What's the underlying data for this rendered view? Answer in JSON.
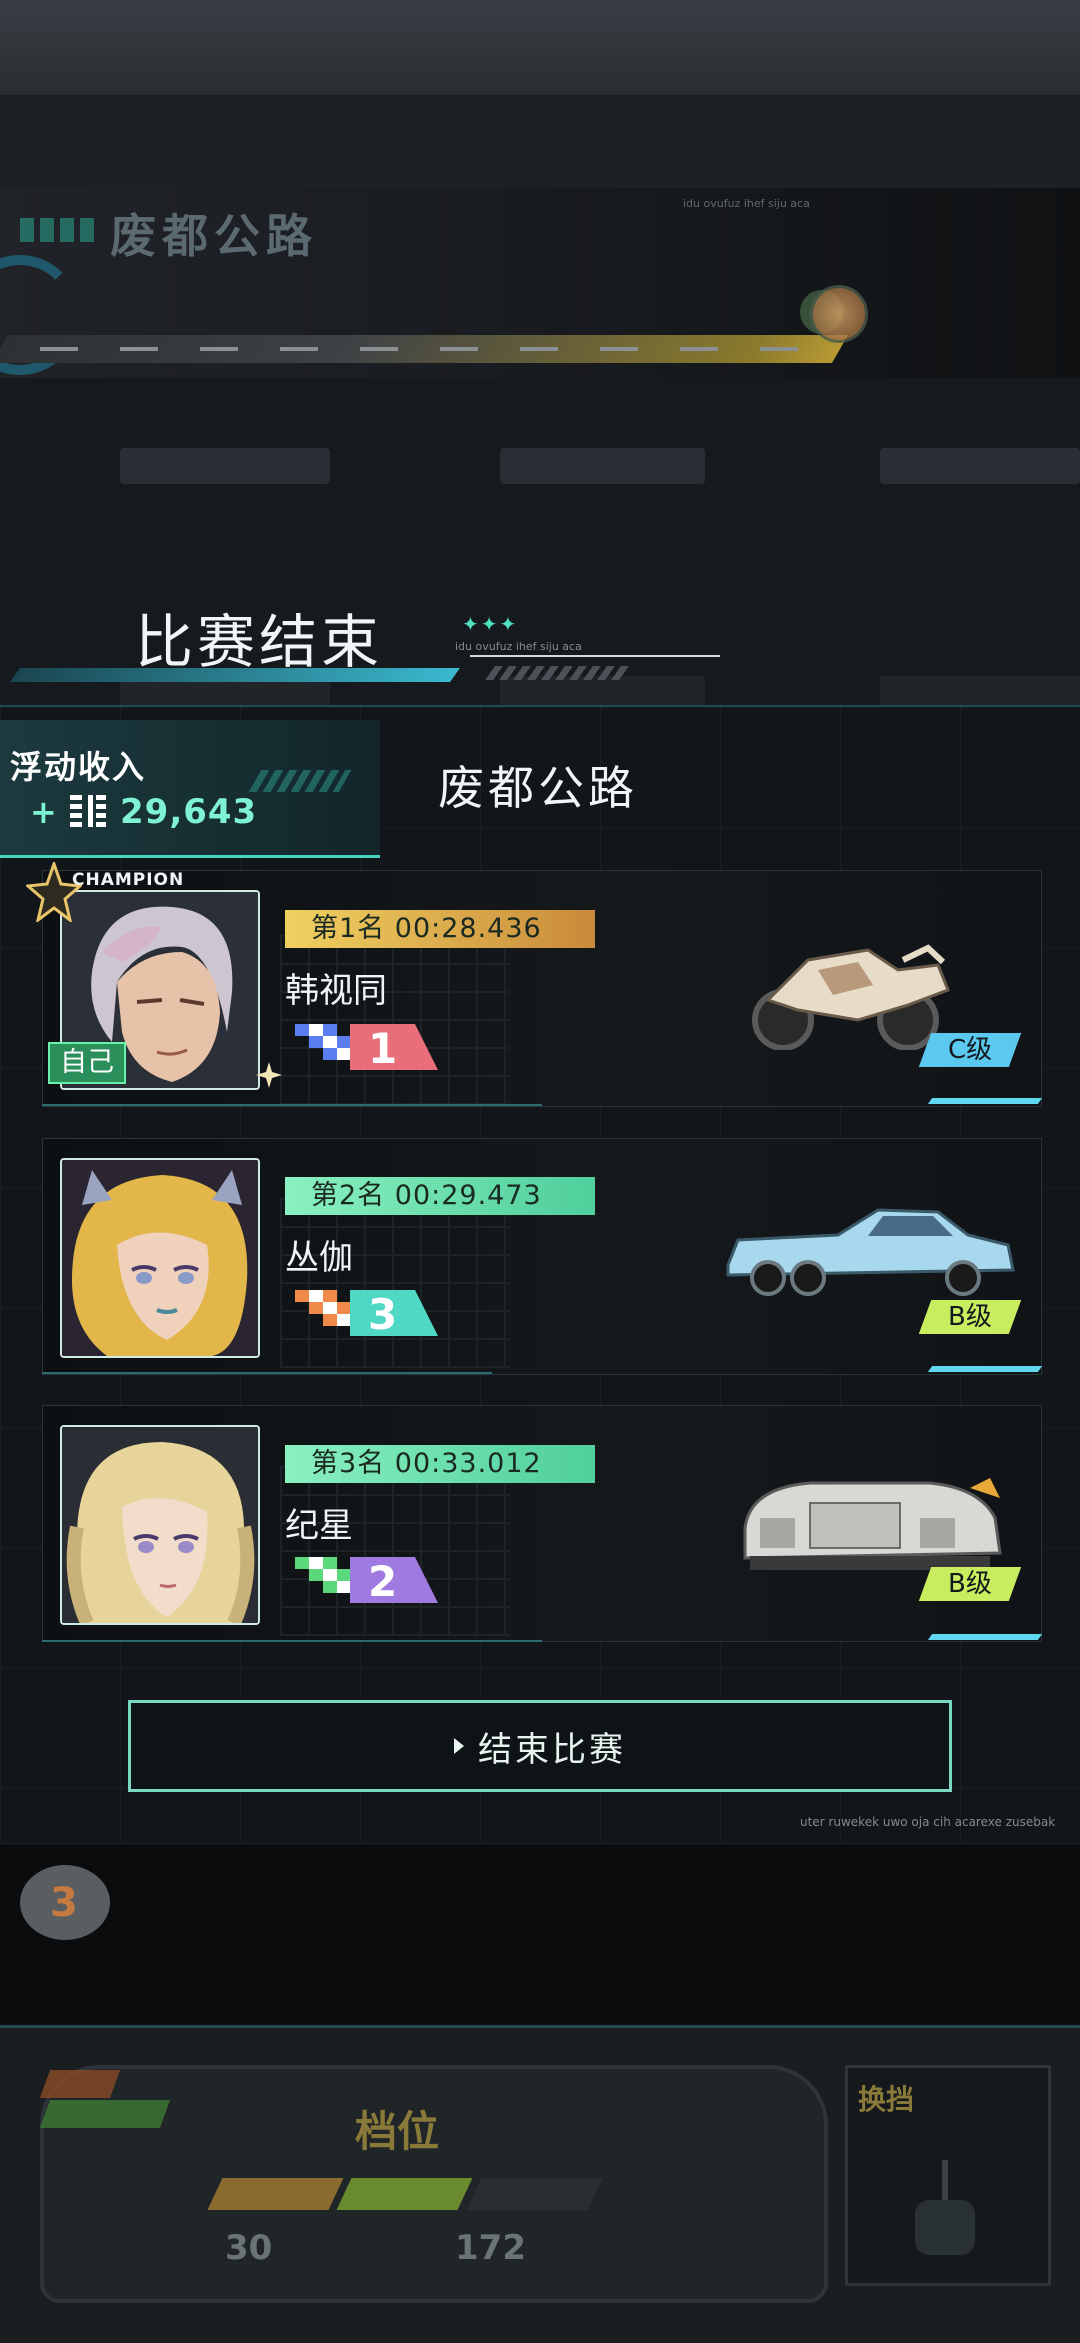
{
  "background": {
    "track_title": "废都公路",
    "deco_top_right": "idu ovufuz ihef siju aca",
    "footer_note": "uter ruwekek uwo oja cih acarexe zusebak",
    "bottom_marker": "3",
    "gauge": {
      "label": "档位",
      "speed_left": "30",
      "speed_right": "172",
      "shift_label": "换挡"
    }
  },
  "header": {
    "title": "比赛结束",
    "deco_stars": "✦✦✦"
  },
  "income": {
    "label": "浮动收入",
    "plus": "+",
    "value": "29,643"
  },
  "route": {
    "name": "废都公路"
  },
  "results": [
    {
      "rank_time": "第1名 00:28.436",
      "name": "韩视同",
      "lap": "1",
      "grade": "C级",
      "is_self": true,
      "self_label": "自己",
      "champion_label": "CHAMPION",
      "badge_color": "#d9a644",
      "lap_color": "#e86f7a",
      "grade_color": "#5bc8ef"
    },
    {
      "rank_time": "第2名 00:29.473",
      "name": "丛伽",
      "lap": "3",
      "grade": "B级",
      "is_self": false,
      "badge_color": "#6fe0b0",
      "lap_color": "#4fd8c4",
      "grade_color": "#c8ee60"
    },
    {
      "rank_time": "第3名 00:33.012",
      "name": "纪星",
      "lap": "2",
      "grade": "B级",
      "is_self": false,
      "badge_color": "#6fe0b0",
      "lap_color": "#9f7ae0",
      "grade_color": "#c8ee60"
    }
  ],
  "end_button": {
    "label": "结束比赛"
  }
}
